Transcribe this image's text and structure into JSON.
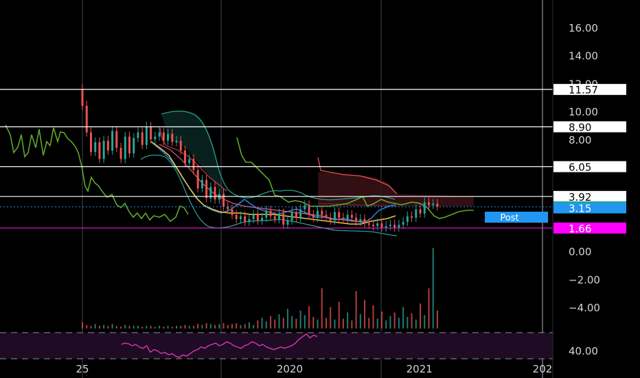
{
  "chart_data": {
    "type": "candlestick",
    "title": "",
    "xlabel": "",
    "ylabel": "",
    "ylim": [
      -5.8,
      17.6
    ],
    "xlim": [
      2018.35,
      2022.05
    ],
    "grid": true,
    "price_axis_ticks": [
      {
        "value": 16,
        "label": "16.00"
      },
      {
        "value": 14,
        "label": "14.00"
      },
      {
        "value": 12,
        "label": "12.00"
      },
      {
        "value": 10,
        "label": "10.00"
      },
      {
        "value": 8,
        "label": "8.00"
      },
      {
        "value": 6,
        "label": "6.00"
      },
      {
        "value": 0,
        "label": "0.00"
      },
      {
        "value": -2,
        "label": "−2.00"
      },
      {
        "value": -4,
        "label": "−4.00"
      }
    ],
    "rsi_tick": {
      "label": "40.00"
    },
    "time_axis_ticks": [
      {
        "value": 2018.4,
        "label": "25"
      },
      {
        "value": 2020.0,
        "label": "2020"
      },
      {
        "value": 2021.0,
        "label": "2021"
      },
      {
        "value": 2021.95,
        "label": "202"
      }
    ],
    "horizontal_levels": [
      {
        "value": 11.57,
        "label": "11.57",
        "line_color": "#ffffff",
        "tag_bg": "#ffffff",
        "tag_fg": "#000000"
      },
      {
        "value": 8.9,
        "label": "8.90",
        "line_color": "#ffffff",
        "tag_bg": "#ffffff",
        "tag_fg": "#000000"
      },
      {
        "value": 6.05,
        "label": "6.05",
        "line_color": "#ffffff",
        "tag_bg": "#ffffff",
        "tag_fg": "#000000"
      },
      {
        "value": 3.92,
        "label": "3.92",
        "line_color": "#ffffff",
        "tag_bg": "#ffffff",
        "tag_fg": "#000000"
      },
      {
        "value": 1.66,
        "label": "1.66",
        "line_color": "#e91ee1",
        "tag_bg": "#ff00ff",
        "tag_fg": "#ffffff"
      }
    ],
    "last_price": {
      "value": 3.18,
      "label": "3.18",
      "tag_bg": "#26a69a",
      "line_color": "#2196f3"
    },
    "post_market": {
      "value": 3.15,
      "label": "3.15",
      "badge": "Post",
      "tag_bg": "#2196f3"
    },
    "colors": {
      "up": "#26a69a",
      "down": "#ef5350",
      "lagging_span": "#5fa82e",
      "bollinger": "#2a9d8f",
      "ma_fast": "#1e88e5",
      "ma_slow": "#f6c744",
      "ichimoku_lead": "#e57373",
      "rsi": "#d63aaf",
      "rsi_band": "#2a0a2e",
      "grid": "#1c1f27",
      "axis_text": "#d1d4dc"
    },
    "series": [
      {
        "kind": "price_ohlc",
        "x_start": 2018.4,
        "x_step": 0.033,
        "close": [
          10.4,
          8.5,
          7.1,
          7.8,
          6.6,
          7.9,
          7.2,
          8.6,
          7.4,
          6.6,
          8.2,
          7.0,
          8.1,
          8.5,
          7.6,
          8.9,
          8.0,
          8.2,
          8.5,
          7.9,
          8.4,
          7.8,
          7.9,
          7.2,
          6.3,
          6.6,
          5.8,
          4.5,
          5.1,
          3.8,
          4.6,
          3.7,
          4.1,
          3.2,
          3.0,
          2.6,
          2.3,
          2.5,
          2.1,
          2.3,
          2.6,
          2.2,
          2.4,
          2.9,
          2.5,
          2.3,
          2.7,
          1.9,
          2.2,
          2.8,
          2.4,
          3.0,
          3.3,
          2.6,
          2.4,
          2.9,
          2.6,
          2.4,
          2.2,
          2.8,
          2.4,
          2.3,
          2.6,
          2.4,
          2.1,
          2.3,
          2.0,
          1.9,
          1.8,
          2.0,
          1.7,
          1.8,
          1.9,
          1.7,
          1.9,
          2.1,
          2.5,
          2.4,
          3.0,
          2.7,
          3.5,
          3.3,
          3.4,
          3.2
        ],
        "open": [
          11.6,
          10.4,
          8.5,
          7.1,
          7.8,
          6.6,
          7.9,
          7.2,
          8.6,
          7.4,
          6.6,
          8.2,
          7.0,
          8.1,
          8.5,
          7.6,
          8.9,
          8.0,
          8.2,
          8.5,
          7.9,
          8.4,
          7.8,
          7.9,
          7.2,
          6.3,
          6.6,
          5.8,
          4.5,
          5.1,
          3.8,
          4.6,
          3.7,
          4.1,
          3.2,
          3.0,
          2.6,
          2.3,
          2.5,
          2.1,
          2.3,
          2.6,
          2.2,
          2.4,
          2.9,
          2.5,
          2.3,
          2.7,
          1.9,
          2.2,
          2.8,
          2.4,
          3.0,
          3.3,
          2.6,
          2.4,
          2.9,
          2.6,
          2.4,
          2.2,
          2.8,
          2.4,
          2.3,
          2.6,
          2.4,
          2.1,
          2.3,
          2.0,
          1.9,
          1.8,
          2.0,
          1.7,
          1.8,
          1.9,
          1.7,
          1.9,
          2.1,
          2.5,
          2.4,
          3.0,
          2.7,
          3.5,
          3.3,
          3.4
        ]
      },
      {
        "kind": "volume",
        "values": [
          0.7,
          0.4,
          0.3,
          0.5,
          0.3,
          0.4,
          0.3,
          0.5,
          0.3,
          0.2,
          0.4,
          0.3,
          0.3,
          0.3,
          0.2,
          0.3,
          0.3,
          0.2,
          0.3,
          0.2,
          0.3,
          0.2,
          0.3,
          0.3,
          0.4,
          0.3,
          0.3,
          0.5,
          0.4,
          0.6,
          0.5,
          0.4,
          0.5,
          0.6,
          0.4,
          0.5,
          0.6,
          0.4,
          0.5,
          0.7,
          0.4,
          0.9,
          1.2,
          0.8,
          1.4,
          1.0,
          1.6,
          1.2,
          2.2,
          1.4,
          1.1,
          2.0,
          1.5,
          2.5,
          1.3,
          1.0,
          4.5,
          1.2,
          2.4,
          1.0,
          3.0,
          1.1,
          1.8,
          0.9,
          4.2,
          1.6,
          3.2,
          1.2,
          2.6,
          1.1,
          1.9,
          0.9,
          1.4,
          1.8,
          1.2,
          2.4,
          1.3,
          1.7,
          1.0,
          2.8,
          1.5,
          4.5,
          9.0,
          2.0
        ]
      },
      {
        "kind": "rsi",
        "x_start": 2018.7,
        "x_step": 0.028,
        "values": [
          46,
          47,
          46.5,
          45,
          46,
          44,
          43,
          45,
          40,
          42,
          41,
          39,
          40,
          38,
          39,
          37,
          36,
          38,
          37,
          39,
          41,
          42,
          44,
          43,
          45,
          46,
          47,
          45,
          46,
          48,
          47,
          45,
          44,
          43,
          45,
          46,
          48,
          47,
          45,
          46,
          44,
          43,
          42,
          43,
          44,
          43,
          44,
          45,
          47,
          50,
          52,
          54,
          51,
          53,
          52
        ]
      }
    ]
  }
}
